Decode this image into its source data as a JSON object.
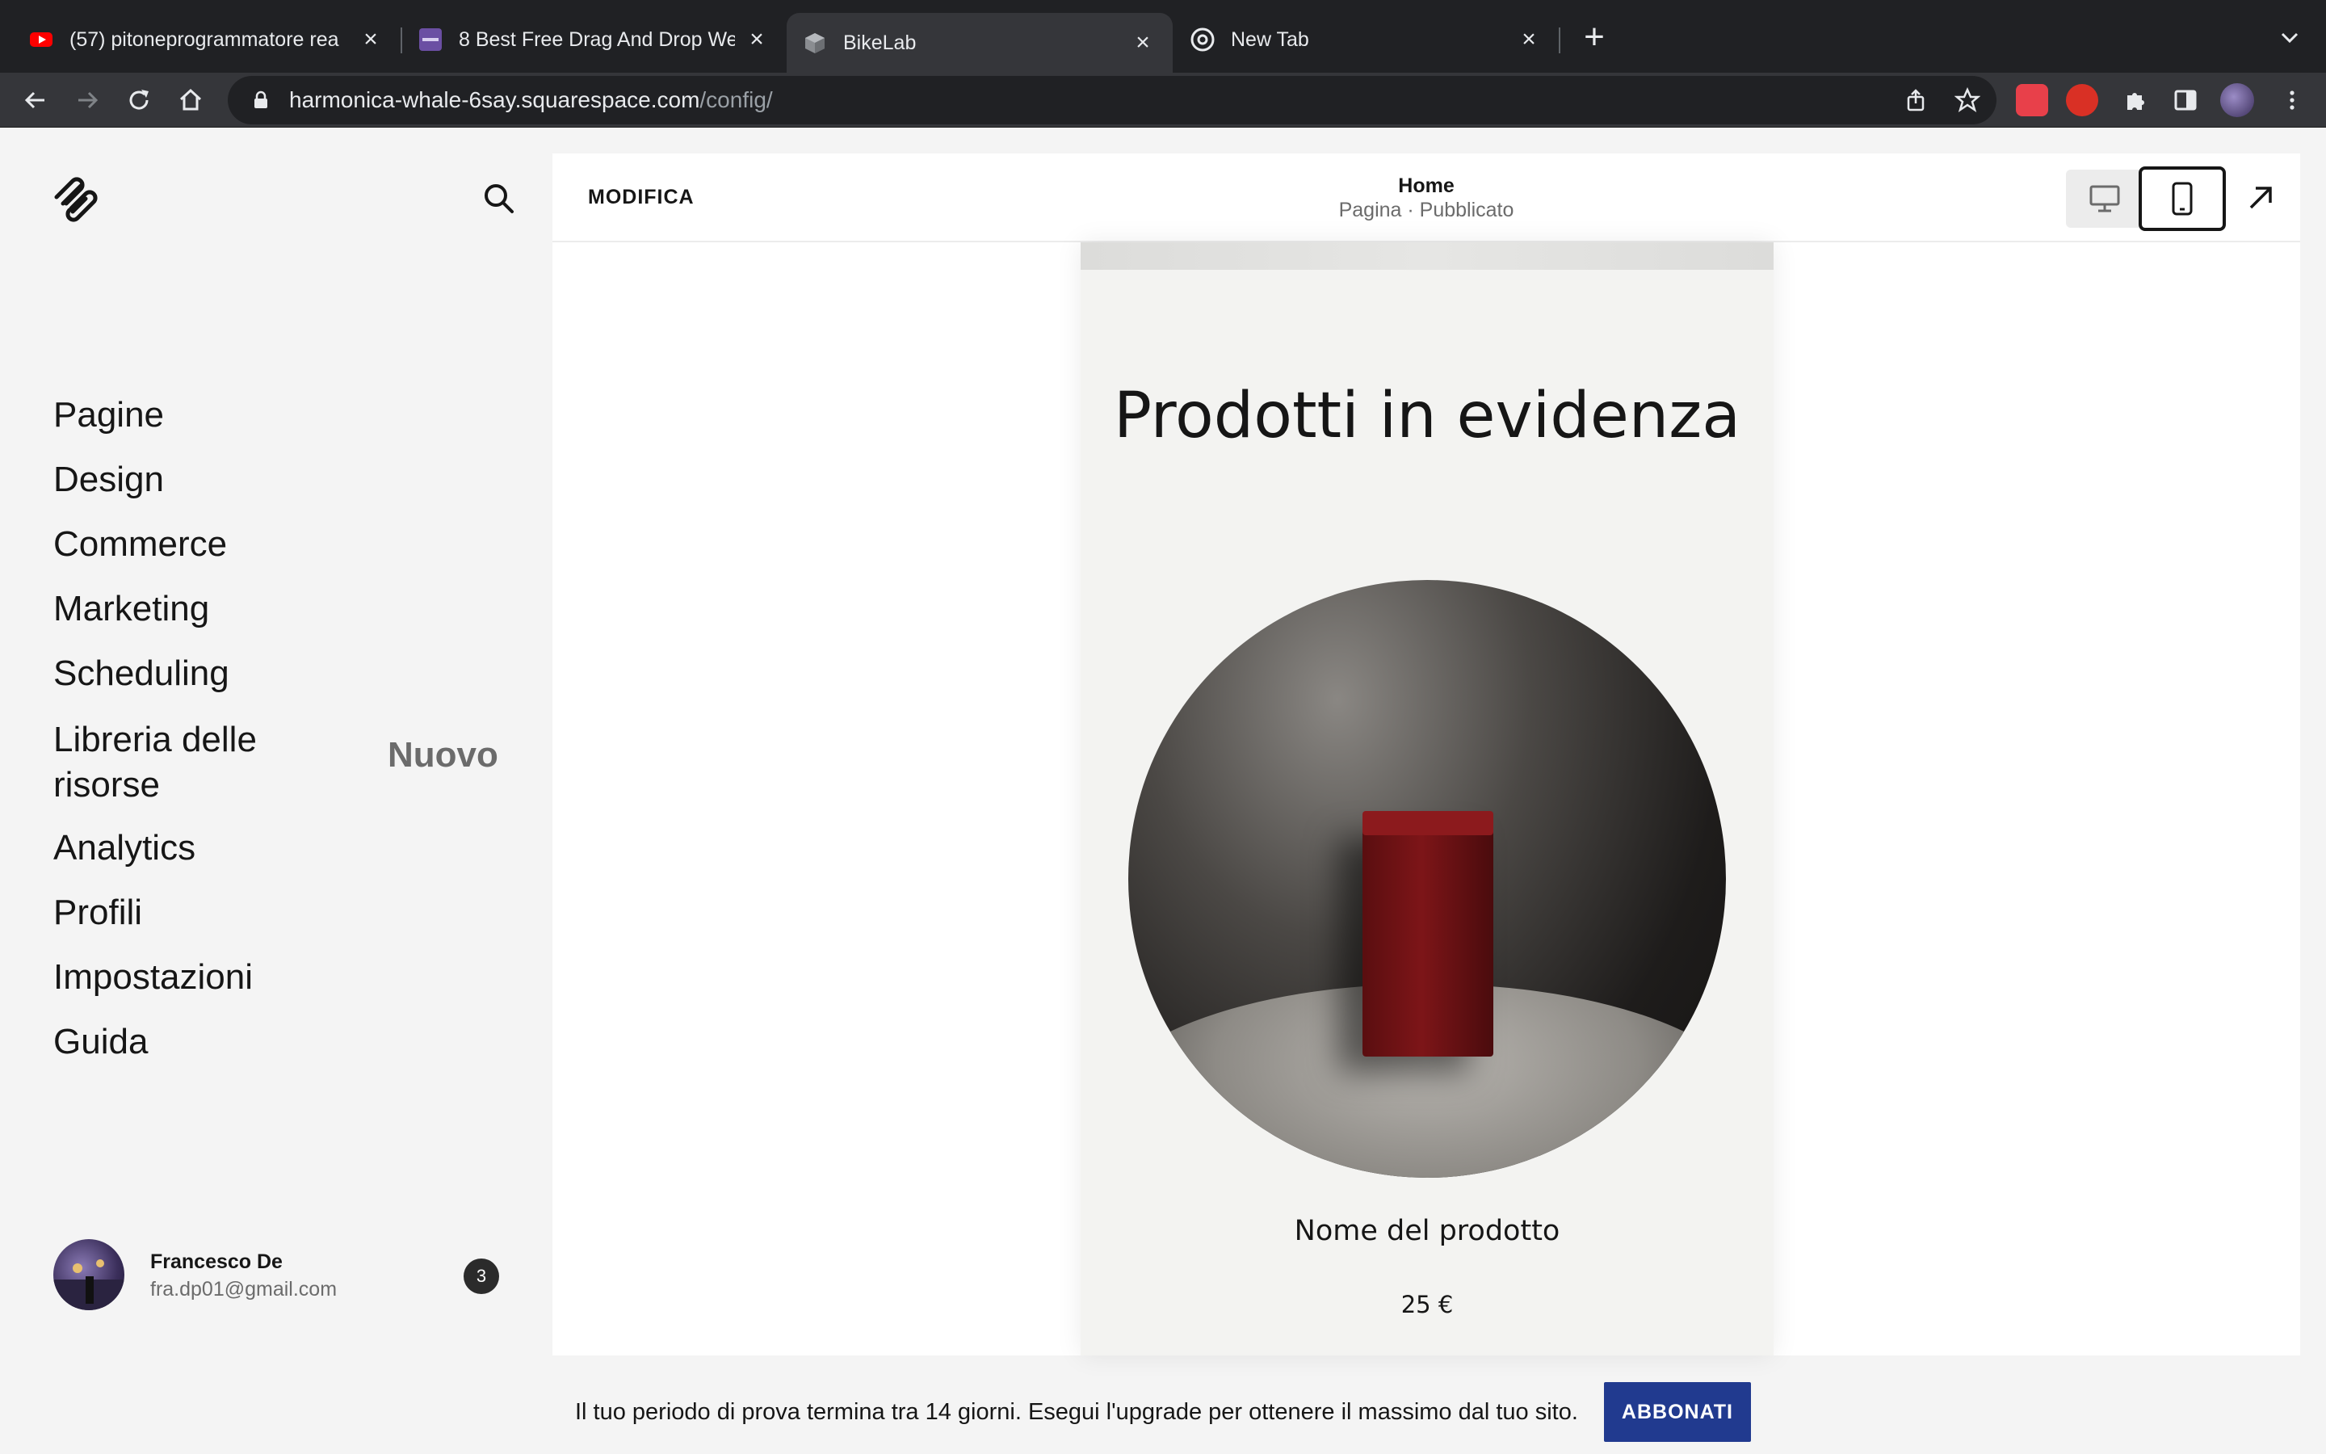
{
  "browser": {
    "tabs": [
      {
        "title": "(57) pitoneprogrammatore rea",
        "favicon": "youtube-icon"
      },
      {
        "title": "8 Best Free Drag And Drop We",
        "favicon": "colorlib-icon"
      },
      {
        "title": "BikeLab",
        "favicon": "squarespace-cube-icon"
      },
      {
        "title": "New Tab",
        "favicon": "chrome-icon"
      }
    ],
    "url_host": "harmonica-whale-6say.squarespace.com",
    "url_path": "/config/"
  },
  "sidebar": {
    "nav": [
      "Pagine",
      "Design",
      "Commerce",
      "Marketing",
      "Scheduling",
      "Libreria delle risorse",
      "Analytics",
      "Profili",
      "Impostazioni",
      "Guida"
    ],
    "nuovo_label": "Nuovo",
    "user": {
      "name": "Francesco De",
      "email": "fra.dp01@gmail.com",
      "notifications": "3"
    }
  },
  "editor": {
    "edit_label": "MODIFICA",
    "page_title": "Home",
    "page_status": "Pagina · Pubblicato",
    "active_view": "mobile"
  },
  "preview": {
    "heading": "Prodotti in evidenza",
    "product_name": "Nome del prodotto",
    "product_price": "25 €"
  },
  "trial": {
    "message": "Il tuo periodo di prova termina tra 14 giorni. Esegui l'upgrade per ottenere il massimo dal tuo sito.",
    "button": "ABBONATI"
  }
}
